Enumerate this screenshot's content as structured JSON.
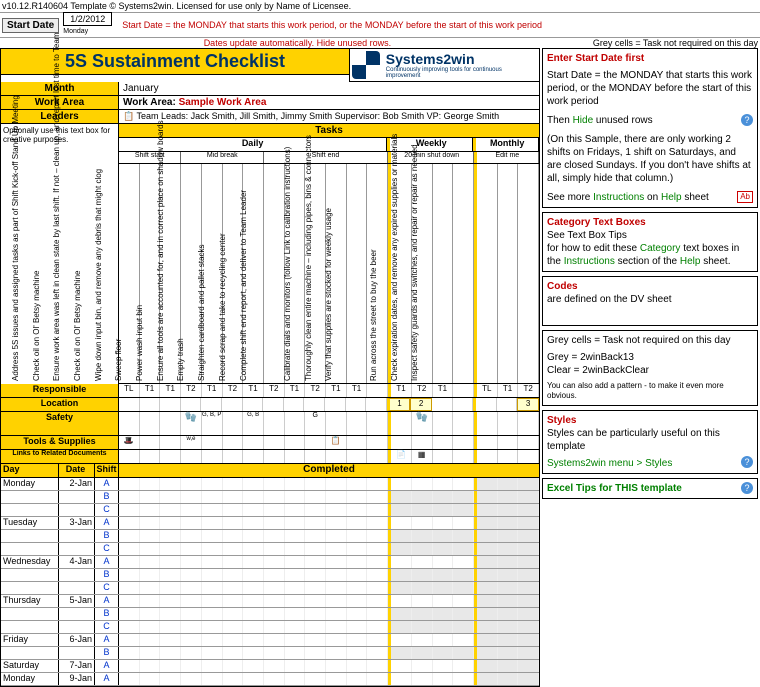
{
  "meta": {
    "version_line": "v10.12.R140604  Template © Systems2win. Licensed for use only by Name of Licensee.",
    "start_date_label": "Start Date",
    "start_date_value": "1/2/2012",
    "start_date_sub": "Monday",
    "warn1": "Start Date = the MONDAY that starts this work period, or the MONDAY before the start of this work period",
    "warn2": "Dates update automatically. Hide unused rows.",
    "warn3": "Grey cells = Task not required on this day"
  },
  "header": {
    "title": "5S Sustainment Checklist",
    "logo_brand": "Systems2win",
    "logo_tag": "Continuously improving tools for continuous improvement",
    "month_label": "Month",
    "month_value": "January",
    "workarea_label": "Work Area",
    "workarea_value_prefix": "Work Area: ",
    "workarea_value": "Sample Work Area",
    "leaders_label": "Leaders",
    "leaders_value": "Team Leads: Jack Smith, Jill Smith, Jimmy Smith  Supervisor: Bob Smith  VP: George Smith",
    "tasks_label": "Tasks",
    "optional_note": "Optionally use this text box for creative purposes."
  },
  "periods": {
    "daily": "Daily",
    "weekly": "Weekly",
    "monthly": "Monthly"
  },
  "subperiods": {
    "shift_start": "Shift start",
    "mid_break": "Mid break",
    "shift_end": "Shift end",
    "shutdown": "20 min shut down",
    "editme": "Edit me"
  },
  "tasks": [
    "Address 5S issues and assigned tasks as part of Shift Kick-off Stand Up Meeting",
    "Check oil on Ol' Betsy machine",
    "Ensure work area was left in clean state by last shift. If not – clean up, and report lost time to Team",
    "Check oil on Ol' Betsy machine",
    "Wipe down input bin, and remove any debris that might clog",
    "Sweep floor",
    "Power wash input bin",
    "Ensure all tools are accounted for, and in correct place on shadow boards",
    "Empty trash",
    "Straighten cardboard and pallet stacks",
    "Record scrap and take to recycling center",
    "Complete shift end report, and deliver to Team Leader",
    "",
    "Calibrate dials and monitors (follow Link to calibration instructions)",
    "Thoroughly clean entire machine – including pipes, bins & connectors",
    "Verify that supplies are stocked for weekly usage",
    "",
    "Run across the street to buy the beer",
    "Check expiration dates, and remove any expired supplies or materials",
    "Inspect safety guards and switches, and repair or repair as needed"
  ],
  "rows": {
    "responsible": "Responsible",
    "location": "Location",
    "safety": "Safety",
    "tools": "Tools & Supplies",
    "links": "Links to Related Documents",
    "resp_values": [
      "TL",
      "T1",
      "T1",
      "T2",
      "T1",
      "T2",
      "T1",
      "T2",
      "T1",
      "T2",
      "T1",
      "T1",
      "",
      "T1",
      "T2",
      "T1",
      "",
      "TL",
      "T1",
      "T2"
    ],
    "loc_values": [
      "",
      "",
      "",
      "",
      "",
      "",
      "",
      "",
      "",
      "",
      "",
      "",
      "",
      "1",
      "2",
      "",
      "",
      "",
      "",
      "3"
    ],
    "glove": "🧤",
    "gbp": "G, B, P",
    "gb": "G, B",
    "g": "G",
    "hat": "🎩",
    "wedot": "w,e",
    "doc": "📄",
    "clip": "📋",
    "xls": "▦"
  },
  "sched_head": {
    "day": "Day",
    "date": "Date",
    "shift": "Shift",
    "completed": "Completed"
  },
  "schedule": [
    {
      "day": "Monday",
      "date": "2-Jan",
      "shifts": [
        "A",
        "B",
        "C"
      ]
    },
    {
      "day": "Tuesday",
      "date": "3-Jan",
      "shifts": [
        "A",
        "B",
        "C"
      ]
    },
    {
      "day": "Wednesday",
      "date": "4-Jan",
      "shifts": [
        "A",
        "B",
        "C"
      ]
    },
    {
      "day": "Thursday",
      "date": "5-Jan",
      "shifts": [
        "A",
        "B",
        "C"
      ]
    },
    {
      "day": "Friday",
      "date": "6-Jan",
      "shifts": [
        "A",
        "B"
      ]
    },
    {
      "day": "Saturday",
      "date": "7-Jan",
      "shifts": [
        "A"
      ]
    },
    {
      "day": "Monday",
      "date": "9-Jan",
      "shifts": [
        "A"
      ]
    }
  ],
  "notes": {
    "n1_title": "Enter Start Date first",
    "n1_body1": "Start Date = the MONDAY that starts this work period, or the MONDAY before the start of this work period",
    "n1_body2a": "Then ",
    "n1_body2b": "Hide",
    "n1_body2c": " unused rows",
    "n1_body3": "(On this Sample, there are only working 2 shifts on Fridays, 1 shift on Saturdays, and are closed Sundays. If you don't have shifts at all, simply hide that column.)",
    "n1_body4a": "See more ",
    "n1_body4b": "Instructions",
    "n1_body4c": " on ",
    "n1_body4d": "Help",
    "n1_body4e": " sheet",
    "n2_title": "Category Text Boxes",
    "n2_body1": "See Text Box Tips",
    "n2_body2a": "for how to edit these ",
    "n2_body2b": "Category",
    "n2_body2c": " text boxes in the ",
    "n2_body2d": "Instructions",
    "n2_body2e": " section of the ",
    "n2_body2f": "Help",
    "n2_body2g": " sheet.",
    "n3_title": "Codes",
    "n3_body": "are defined on the DV sheet",
    "n4_body1": "Grey cells = Task not required on this day",
    "n4_body2": "Grey = 2winBack13",
    "n4_body3": "Clear = 2winBackClear",
    "n4_body4": "You can also add a pattern - to make it even more obvious.",
    "n5_title": "Styles",
    "n5_body1": "Styles can be particularly useful on this template",
    "n5_body2": "Systems2win menu > Styles",
    "n6_title": "Excel Tips for THIS template",
    "ab": "Ab"
  }
}
